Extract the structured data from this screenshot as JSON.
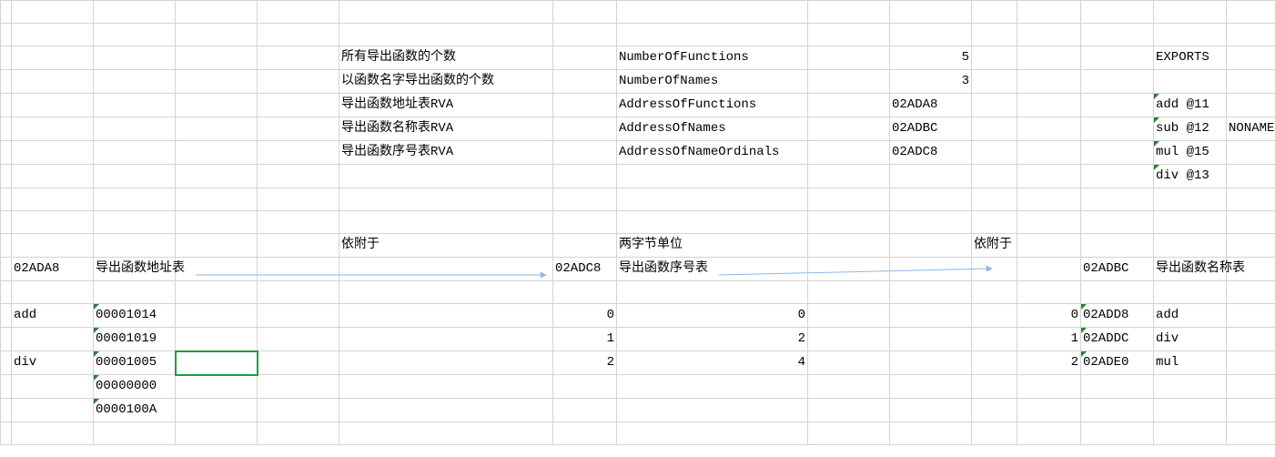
{
  "header_block": {
    "rows": [
      {
        "desc": "所有导出函数的个数",
        "field": "NumberOfFunctions",
        "val": "5",
        "val_align": "num"
      },
      {
        "desc": "以函数名字导出函数的个数",
        "field": "NumberOfNames",
        "val": "3",
        "val_align": "num"
      },
      {
        "desc": "导出函数地址表RVA",
        "field": "AddressOfFunctions",
        "val": "02ADA8",
        "val_align": ""
      },
      {
        "desc": "导出函数名称表RVA",
        "field": "AddressOfNames",
        "val": "02ADBC",
        "val_align": ""
      },
      {
        "desc": "导出函数序号表RVA",
        "field": "AddressOfNameOrdinals",
        "val": "02ADC8",
        "val_align": ""
      }
    ]
  },
  "exports_block": {
    "title": "EXPORTS",
    "items": [
      {
        "text": "add @11",
        "extra": ""
      },
      {
        "text": "sub @12",
        "extra": "NONAME"
      },
      {
        "text": "mul @15",
        "extra": ""
      },
      {
        "text": "div @13",
        "extra": ""
      }
    ]
  },
  "labels": {
    "depends_left": "依附于",
    "depends_right": "依附于",
    "two_byte": "两字节单位",
    "addr_left_key": "02ADA8",
    "addr_left_name": "导出函数地址表",
    "addr_mid_key": "02ADC8",
    "addr_mid_name": "导出函数序号表",
    "addr_right_key": "02ADBC",
    "addr_right_name": "导出函数名称表"
  },
  "func_table": {
    "rows": [
      {
        "name": "add",
        "rva": "00001014"
      },
      {
        "name": "",
        "rva": "00001019"
      },
      {
        "name": "div",
        "rva": "00001005"
      },
      {
        "name": "",
        "rva": "00000000"
      },
      {
        "name": "",
        "rva": "0000100A"
      }
    ]
  },
  "ordinal_table": {
    "rows": [
      {
        "idx": "0",
        "ord": "0"
      },
      {
        "idx": "1",
        "ord": "2"
      },
      {
        "idx": "2",
        "ord": "4"
      }
    ]
  },
  "name_table": {
    "rows": [
      {
        "idx": "0",
        "addr": "02ADD8",
        "name": "add"
      },
      {
        "idx": "1",
        "addr": "02ADDC",
        "name": "div"
      },
      {
        "idx": "2",
        "addr": "02ADE0",
        "name": "mul"
      }
    ]
  },
  "chart_data": {
    "type": "table",
    "title": "PE Export Table Layout",
    "directory": {
      "NumberOfFunctions": 5,
      "NumberOfNames": 3,
      "AddressOfFunctions": "02ADA8",
      "AddressOfNames": "02ADBC",
      "AddressOfNameOrdinals": "02ADC8"
    },
    "exports_def": [
      {
        "name": "add",
        "ordinal": 11
      },
      {
        "name": "sub",
        "ordinal": 12,
        "noname": true
      },
      {
        "name": "mul",
        "ordinal": 15
      },
      {
        "name": "div",
        "ordinal": 13
      }
    ],
    "AddressOfFunctions@02ADA8": [
      {
        "index": 0,
        "name": "add",
        "rva": "00001014"
      },
      {
        "index": 1,
        "name": "",
        "rva": "00001019"
      },
      {
        "index": 2,
        "name": "div",
        "rva": "00001005"
      },
      {
        "index": 3,
        "name": "",
        "rva": "00000000"
      },
      {
        "index": 4,
        "name": "",
        "rva": "0000100A"
      }
    ],
    "AddressOfNameOrdinals@02ADC8": [
      {
        "index": 0,
        "ordinal": 0
      },
      {
        "index": 1,
        "ordinal": 2
      },
      {
        "index": 2,
        "ordinal": 4
      }
    ],
    "AddressOfNames@02ADBC": [
      {
        "index": 0,
        "rva": "02ADD8",
        "name": "add"
      },
      {
        "index": 1,
        "rva": "02ADDC",
        "name": "div"
      },
      {
        "index": 2,
        "rva": "02ADE0",
        "name": "mul"
      }
    ]
  }
}
